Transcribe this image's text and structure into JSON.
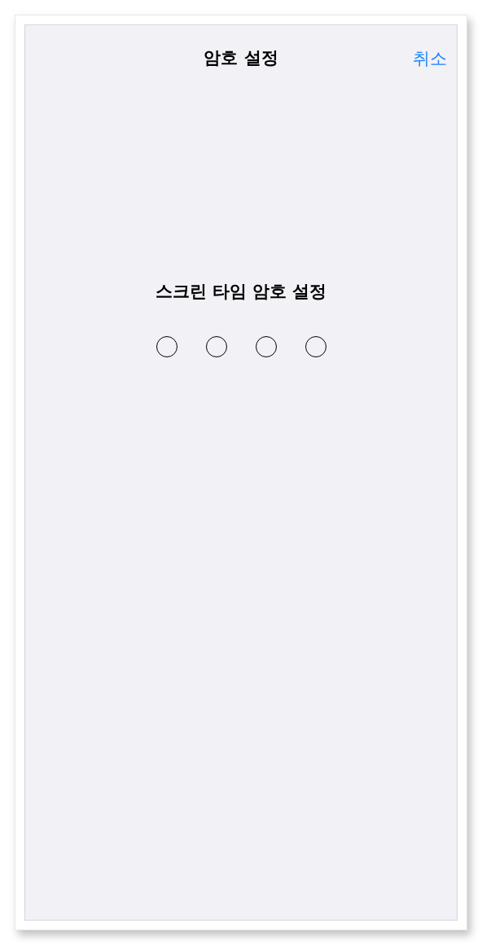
{
  "nav": {
    "title": "암호 설정",
    "cancel": "취소"
  },
  "prompt": "스크린 타임 암호 설정",
  "passcode_dots": [
    {
      "filled": false
    },
    {
      "filled": false
    },
    {
      "filled": false
    },
    {
      "filled": false
    }
  ]
}
